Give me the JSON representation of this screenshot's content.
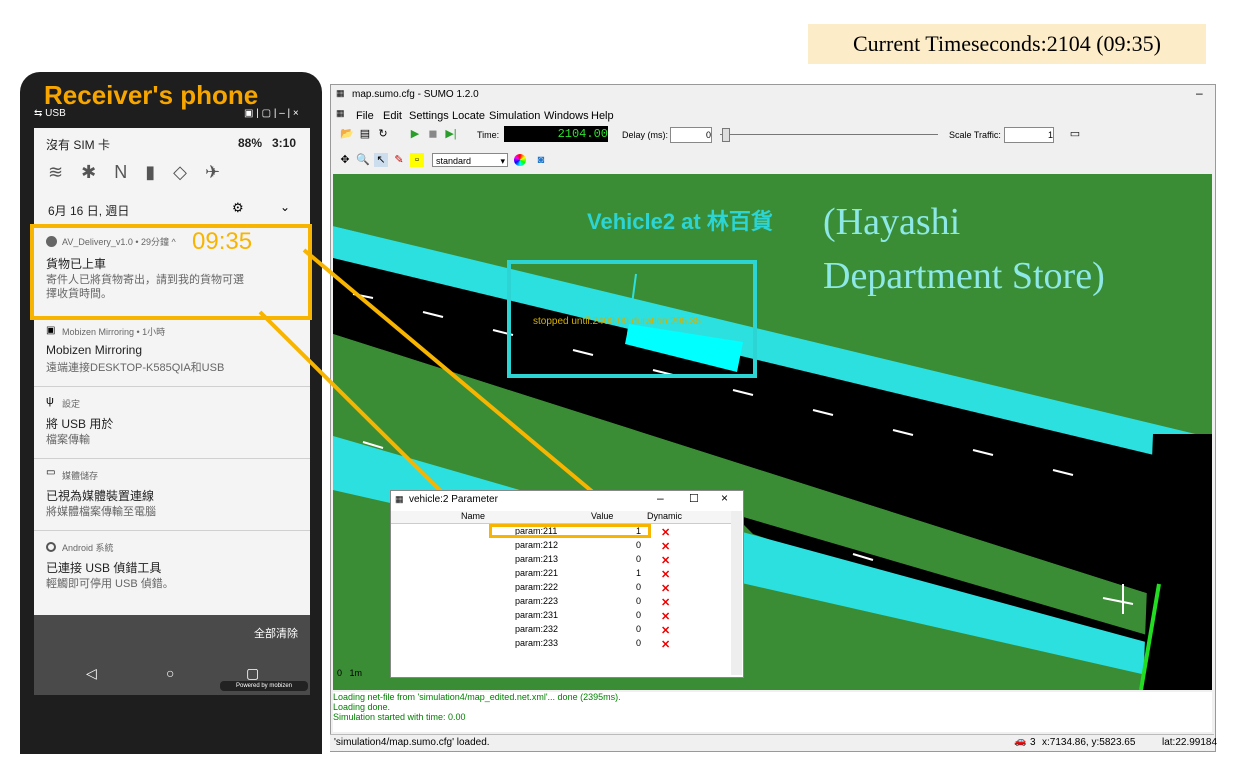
{
  "banner": {
    "text": "Current Timeseconds:2104 (09:35)"
  },
  "phone": {
    "title": "Receiver's phone",
    "usb_label": "USB",
    "carrier": "沒有 SIM 卡",
    "battery": "88%",
    "time": "3:10",
    "date": "6月 16 日, 週日",
    "notifications": [
      {
        "app": "AV_Delivery_v1.0 • 29分鐘 ^",
        "title": "貨物已上車",
        "body1": "寄件人已將貨物寄出，請到我的貨物可選",
        "body2": "擇收貨時間。",
        "highlight_time": "09:35"
      },
      {
        "app": "Mobizen Mirroring • 1小時",
        "title": "Mobizen Mirroring",
        "body1": "遠端連接DESKTOP-K585QIA和USB"
      },
      {
        "app": "設定",
        "title": "將 USB 用於",
        "body1": "檔案傳輸"
      },
      {
        "app": "媒體儲存",
        "title": "已視為媒體裝置連線",
        "body1": "將媒體檔案傳輸至電腦"
      },
      {
        "app": "Android 系統",
        "title": "已連接 USB 偵錯工具",
        "body1": "輕觸即可停用 USB 偵錯。"
      }
    ],
    "clear_all": "全部清除",
    "powered_by": "Powered by mobizen"
  },
  "sumo": {
    "window_title": "map.sumo.cfg - SUMO 1.2.0",
    "menu": [
      "File",
      "Edit",
      "Settings",
      "Locate",
      "Simulation",
      "Windows",
      "Help"
    ],
    "time_label": "Time:",
    "time_value": "2104.00",
    "delay_label": "Delay (ms):",
    "delay_value": "0",
    "scale_label": "Scale Traffic:",
    "scale_value": "1",
    "scheme": "standard",
    "vehicle_label": "Vehicle2 at 林百貨",
    "store_label_1": "(Hayashi",
    "store_label_2": "Department Store)",
    "stopped_text": "stopped until:2400.00 duration:295.35",
    "scale_bar": "0   1m",
    "log": [
      "Loading net-file from 'simulation4/map_edited.net.xml'... done (2395ms).",
      "Loading done.",
      "Simulation started with time: 0.00"
    ],
    "status": "'simulation4/map.sumo.cfg' loaded.",
    "status_count": "3",
    "coords": "x:7134.86, y:5823.65",
    "lat": "lat:22.99184"
  },
  "param_dialog": {
    "title": "vehicle:2 Parameter",
    "headers": [
      "Name",
      "Value",
      "Dynamic"
    ],
    "rows": [
      {
        "name": "param:211",
        "value": "1"
      },
      {
        "name": "param:212",
        "value": "0"
      },
      {
        "name": "param:213",
        "value": "0"
      },
      {
        "name": "param:221",
        "value": "1"
      },
      {
        "name": "param:222",
        "value": "0"
      },
      {
        "name": "param:223",
        "value": "0"
      },
      {
        "name": "param:231",
        "value": "0"
      },
      {
        "name": "param:232",
        "value": "0"
      },
      {
        "name": "param:233",
        "value": "0"
      }
    ]
  },
  "colors": {
    "accent": "#f7b400",
    "teal": "#2dd4d4",
    "road": "#000000",
    "grass": "#3a8d35"
  }
}
